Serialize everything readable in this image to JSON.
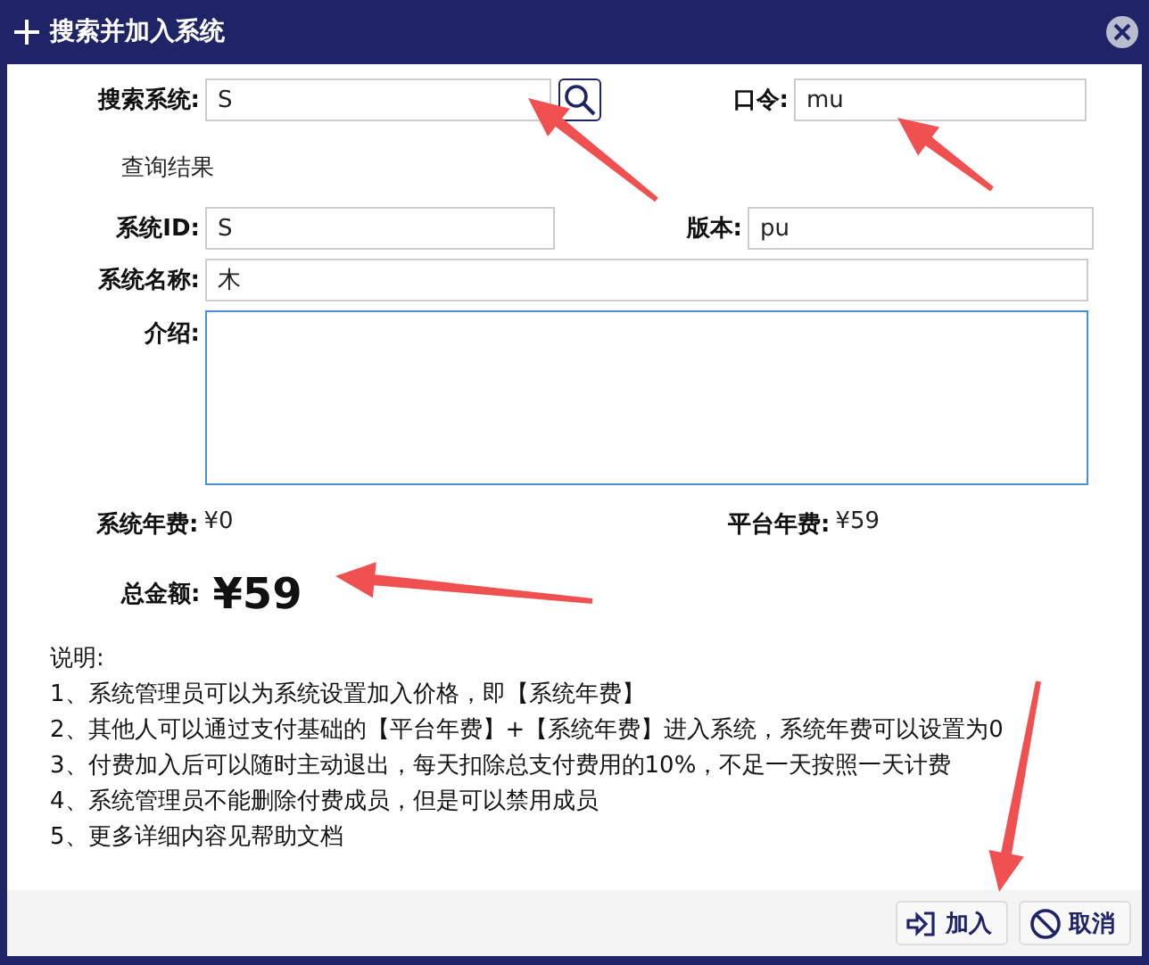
{
  "dialog": {
    "title": "搜索并加入系统"
  },
  "search": {
    "label": "搜索系统:",
    "value": "S"
  },
  "password": {
    "label": "口令:",
    "value": "mu"
  },
  "result_heading": "查询结果",
  "system_id": {
    "label": "系统ID:",
    "value": "S"
  },
  "version": {
    "label": "版本:",
    "value": "pu"
  },
  "system_name": {
    "label": "系统名称:",
    "value": "木"
  },
  "description": {
    "label": "介绍:"
  },
  "fees": [
    {
      "label": "系统年费:",
      "value": "¥0"
    },
    {
      "label": "平台年费:",
      "value": "¥59"
    }
  ],
  "total": {
    "label": "总金额:",
    "value": "¥59"
  },
  "notes": [
    "说明:",
    "1、系统管理员可以为系统设置加入价格，即【系统年费】",
    "2、其他人可以通过支付基础的【平台年费】+【系统年费】进入系统，系统年费可以设置为0",
    "3、付费加入后可以随时主动退出，每天扣除总支付费用的10%，不足一天按照一天计费",
    "4、系统管理员不能删除付费成员，但是可以禁用成员",
    "5、更多详细内容见帮助文档"
  ],
  "buttons": [
    {
      "label": "加入",
      "kind": "join"
    },
    {
      "label": "取消",
      "kind": "cancel"
    }
  ]
}
